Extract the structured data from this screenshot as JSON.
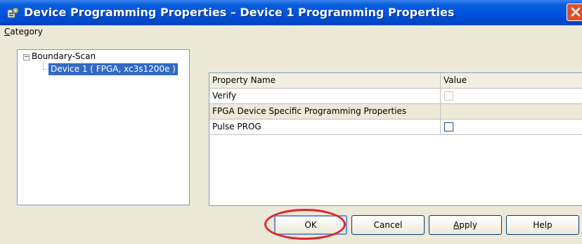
{
  "window": {
    "title": "Device Programming Properties – Device 1 Programming Properties",
    "app_icon": "programming-properties-icon",
    "close_icon": "close-icon"
  },
  "category": {
    "label_accel": "C",
    "label_rest": "ategory",
    "tree": {
      "root": {
        "label": "Boundary-Scan",
        "expander": "−"
      },
      "children": [
        {
          "label": "Device 1 ( FPGA, xc3s1200e )",
          "selected": true
        }
      ]
    }
  },
  "properties": {
    "columns": [
      "Property Name",
      "Value"
    ],
    "rows": [
      {
        "name": "Verify",
        "kind": "checkbox",
        "checked": false,
        "enabled": false
      },
      {
        "name": "FPGA Device Specific Programming Properties",
        "kind": "category"
      },
      {
        "name": "Pulse PROG",
        "kind": "checkbox",
        "checked": false,
        "enabled": true
      }
    ]
  },
  "buttons": {
    "ok": "OK",
    "cancel": "Cancel",
    "apply_accel": "A",
    "apply_rest": "pply",
    "help": "Help"
  },
  "annotation": {
    "color": "#e3232a",
    "target": "ok-button"
  },
  "colors": {
    "titlebar": "#0054e3",
    "selection": "#316ac5",
    "dialog_bg": "#ece9d8"
  }
}
